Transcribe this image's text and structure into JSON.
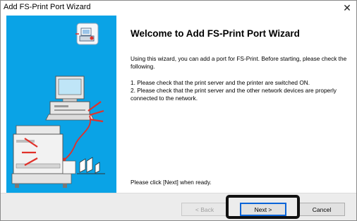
{
  "window": {
    "title": "Add FS-Print Port Wizard",
    "close_glyph": "✕"
  },
  "main": {
    "heading": "Welcome to Add FS-Print Port Wizard",
    "intro": "Using this wizard, you can add a port for FS-Print. Before starting, please check the following.",
    "step1": "1. Please check that the print server and the printer are switched ON.",
    "step2": "2. Please check that the print server and the other network devices are properly connected to the network.",
    "ready": "Please click [Next] when ready."
  },
  "buttons": {
    "back": "< Back",
    "next": "Next >",
    "cancel": "Cancel"
  },
  "colors": {
    "side_panel": "#0aa3e6",
    "highlight_frame": "#111111",
    "accent_red": "#e0312a"
  },
  "icons": [
    "wizard-port-icon",
    "computer-icon",
    "printer-icon",
    "connection-cable"
  ]
}
